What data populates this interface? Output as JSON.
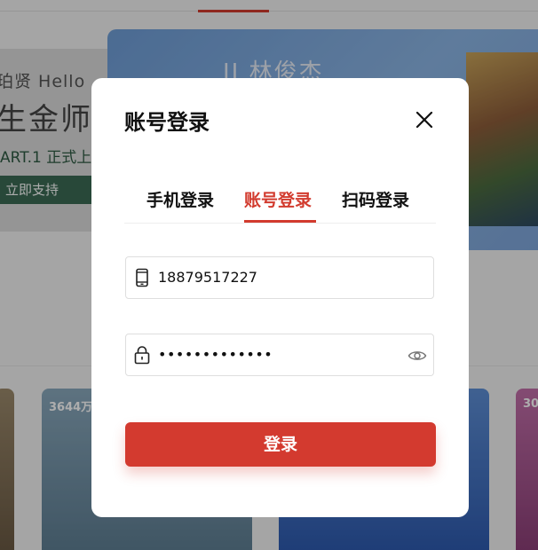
{
  "background": {
    "banner_left": {
      "line1": "珀贤 Hello",
      "line2": "生金师",
      "line3": "ART.1  正式上",
      "support_label": "立即支持"
    },
    "banner_right": {
      "artist": "JJ 林俊杰"
    },
    "cards": [
      {
        "count": ""
      },
      {
        "count": "3644万"
      },
      {
        "count": ""
      },
      {
        "count": "30"
      }
    ]
  },
  "modal": {
    "title": "账号登录",
    "tabs": [
      {
        "label": "手机登录",
        "active": false
      },
      {
        "label": "账号登录",
        "active": true
      },
      {
        "label": "扫码登录",
        "active": false
      }
    ],
    "phone": {
      "value": "18879517227",
      "icon": "phone-icon"
    },
    "password": {
      "value": "•••••••••••••",
      "icon": "lock-icon",
      "toggle_icon": "eye-icon"
    },
    "submit_label": "登录"
  },
  "colors": {
    "accent": "#d23b2e",
    "button": "#d33a2f",
    "overlay": "rgba(0,0,0,0.32)"
  }
}
